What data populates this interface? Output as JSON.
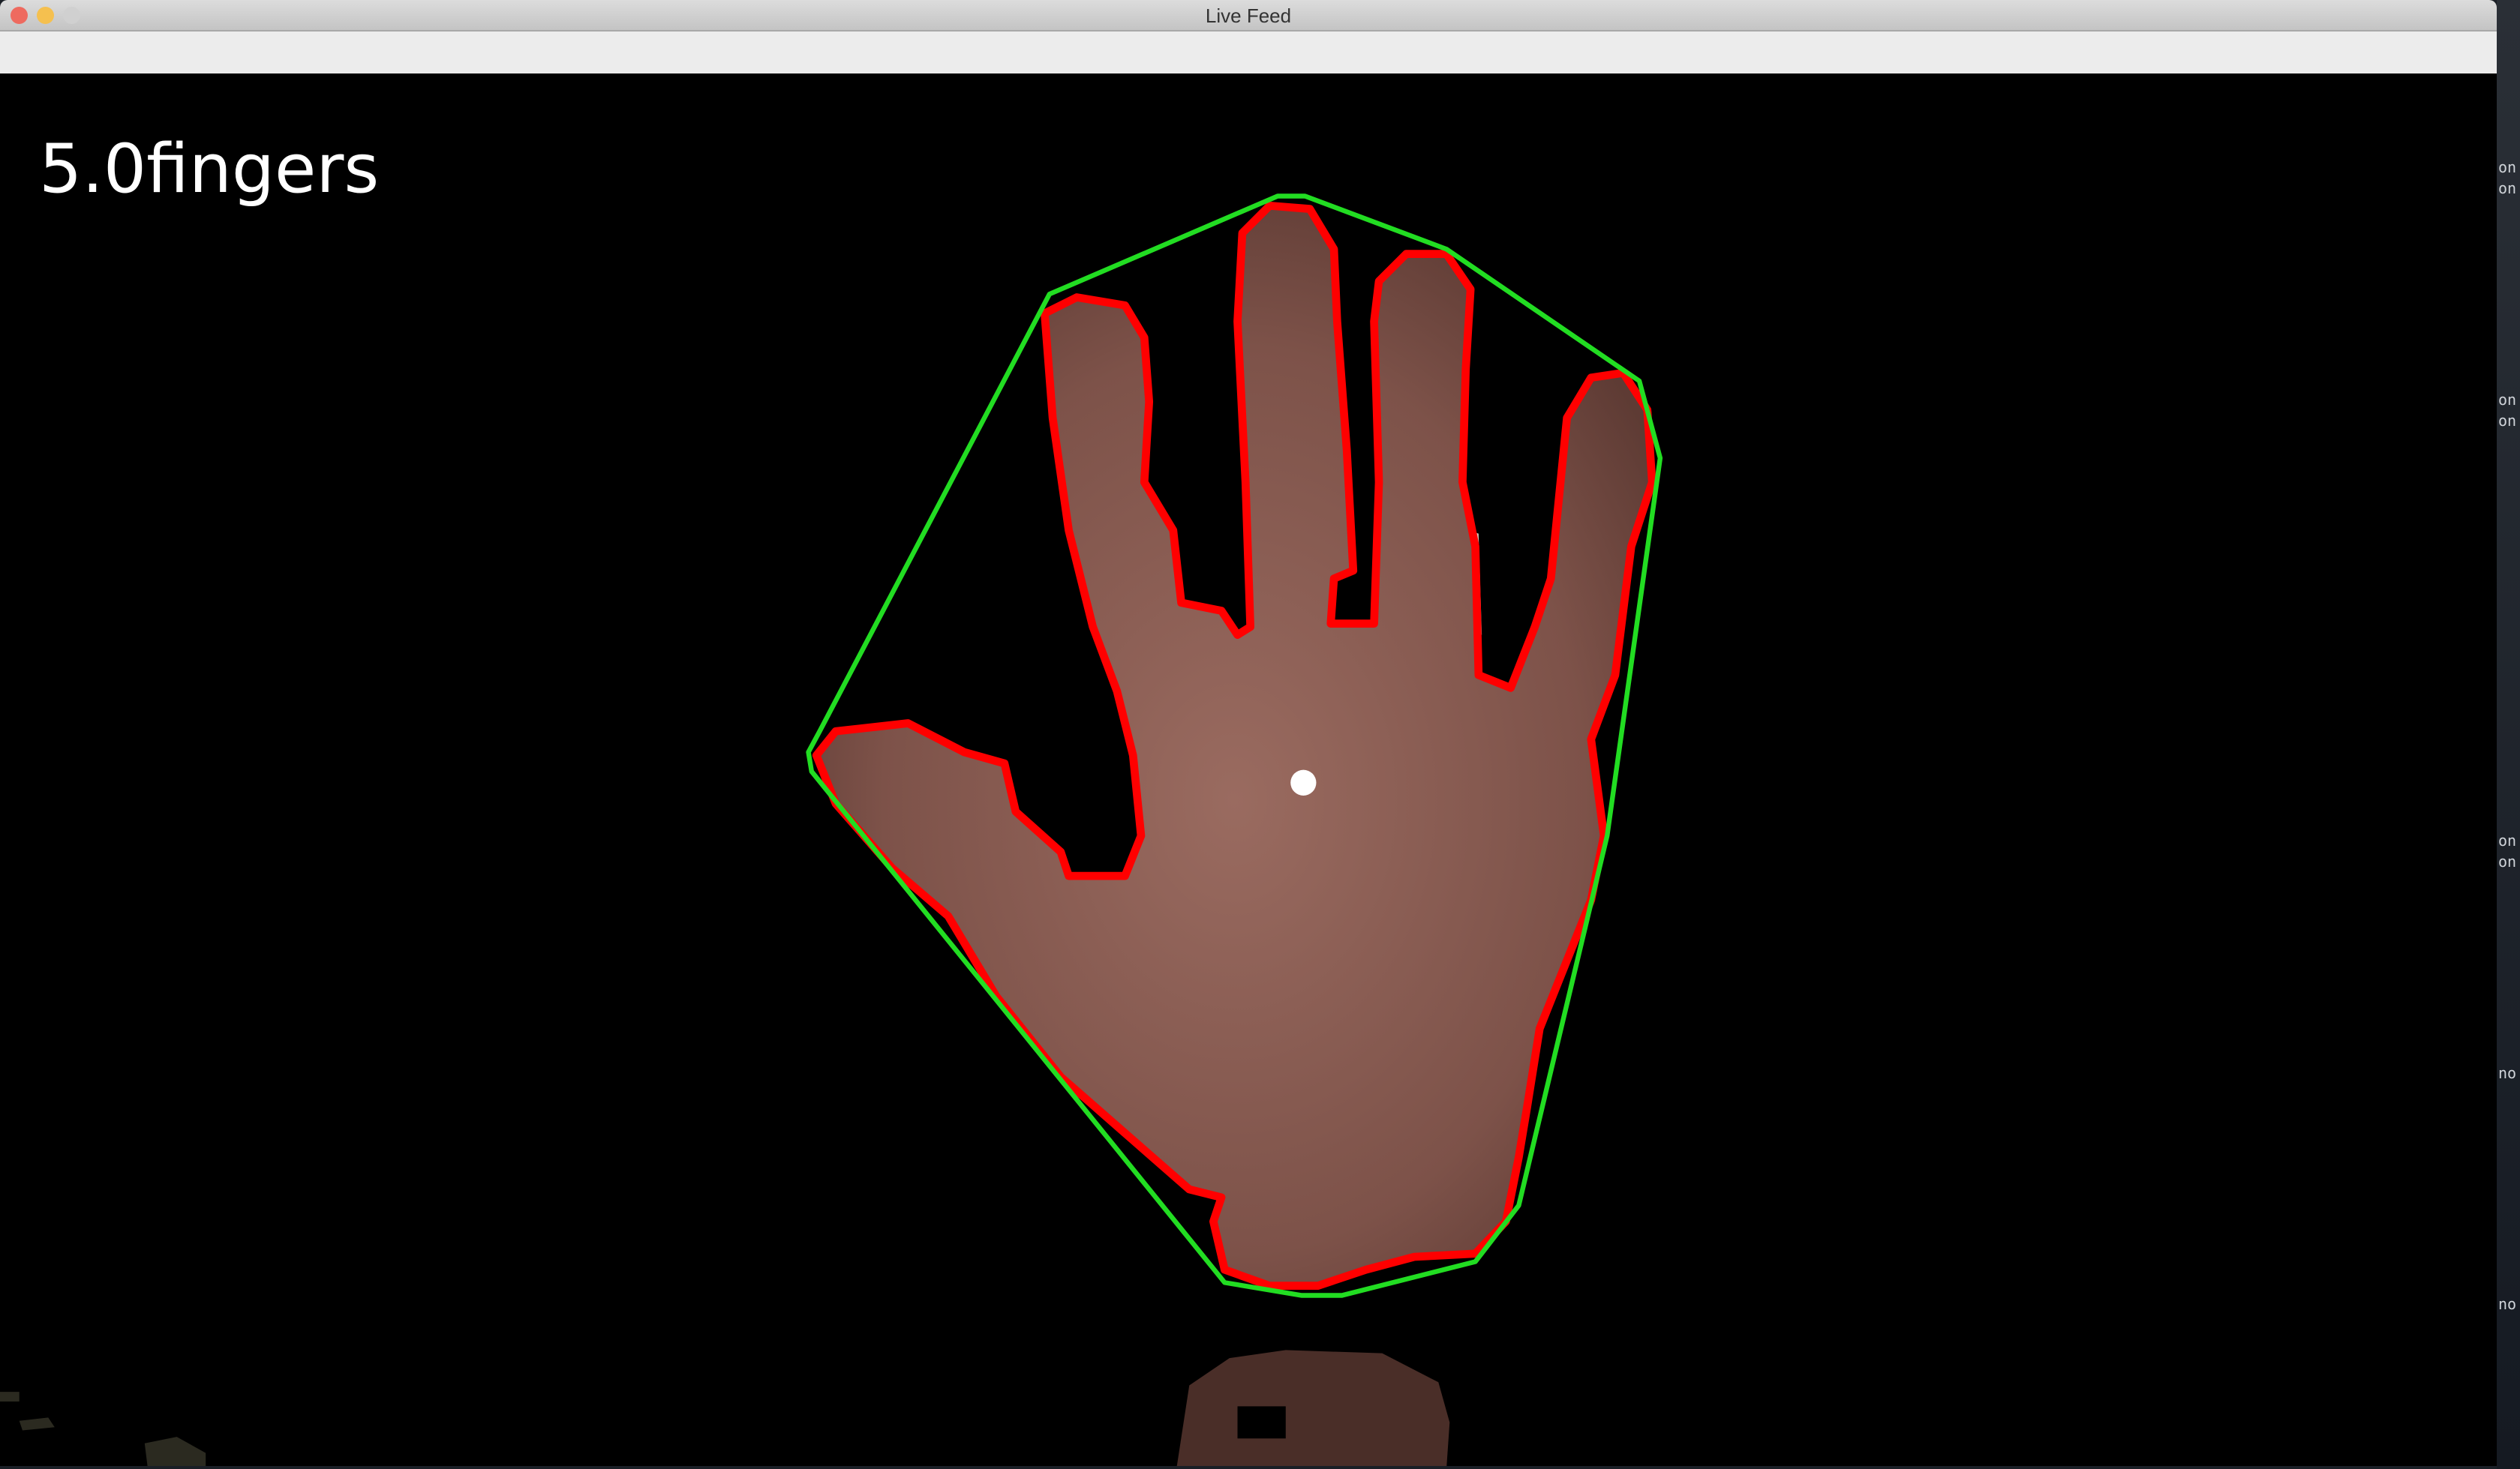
{
  "window": {
    "title": "Live Feed"
  },
  "feed": {
    "finger_count_label": "5.0fingers"
  },
  "colors": {
    "contour": "#ff0000",
    "hull": "#22dd22",
    "centroid": "#ffffff",
    "background": "#000000"
  },
  "desktop_fragments": [
    "on",
    "on",
    "on",
    "on",
    "on",
    "on",
    "no",
    "no"
  ]
}
